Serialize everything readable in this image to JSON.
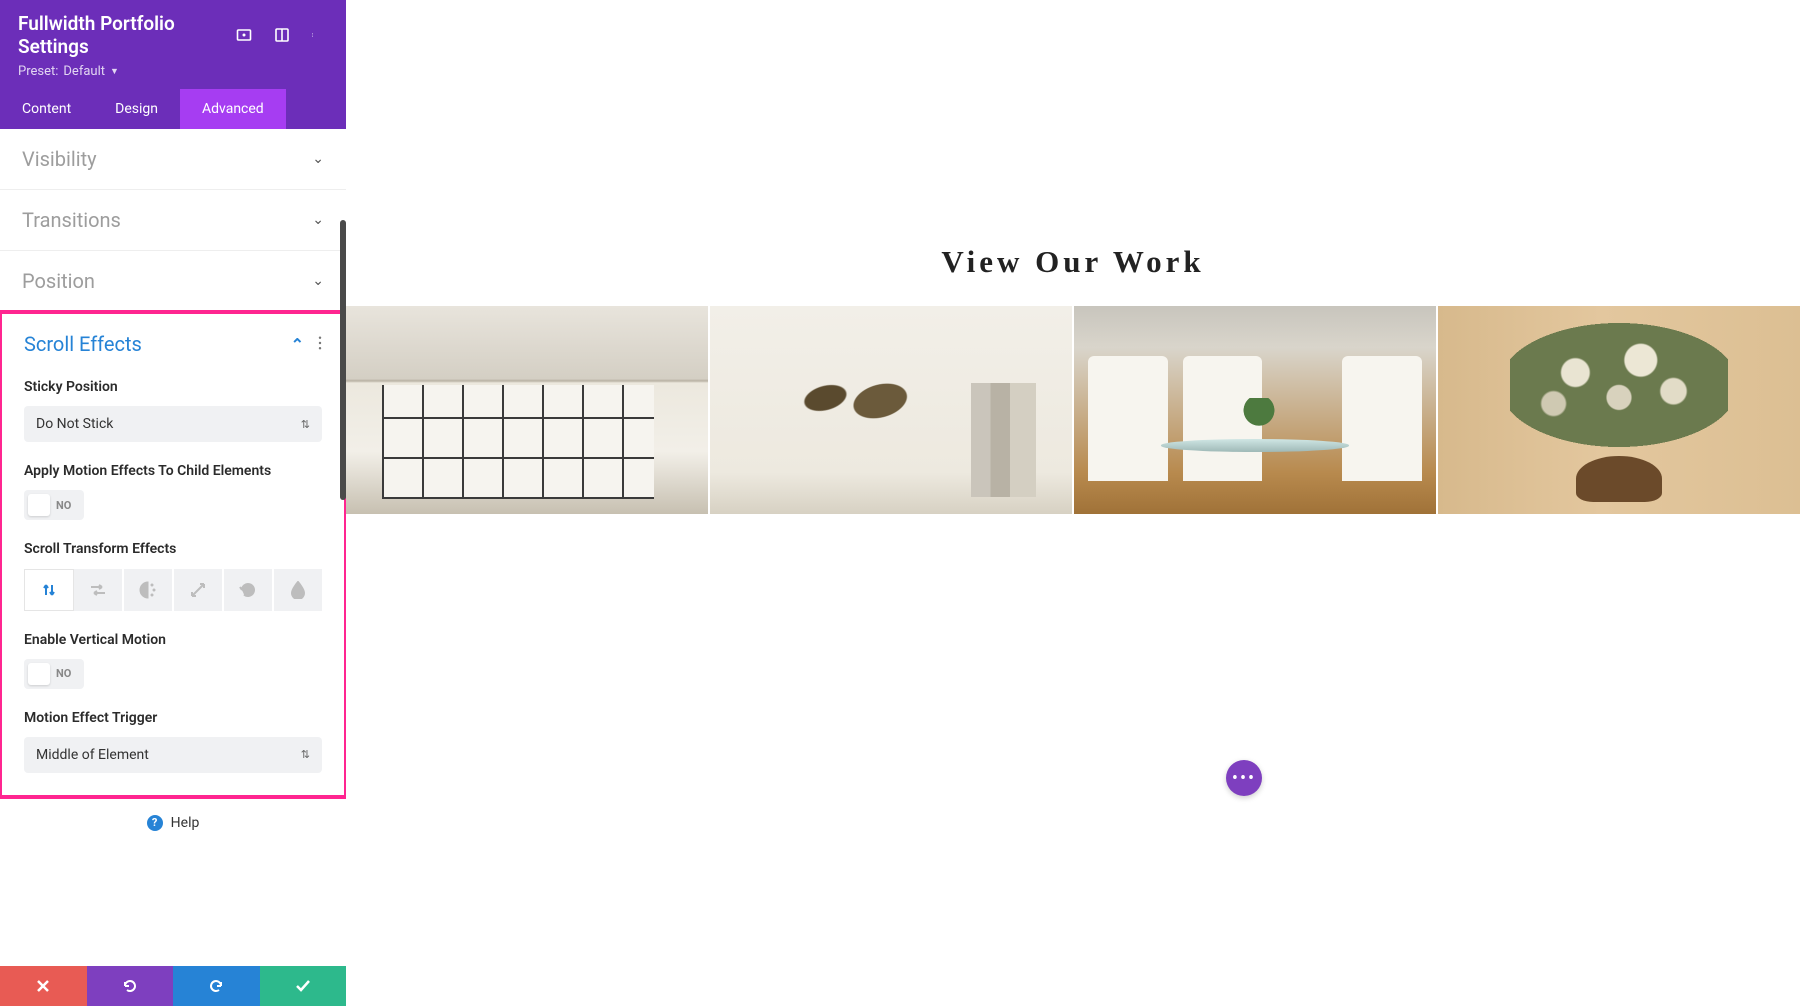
{
  "sidebar": {
    "title": "Fullwidth Portfolio Settings",
    "preset_label": "Preset:",
    "preset_value": "Default",
    "tabs": {
      "content": "Content",
      "design": "Design",
      "advanced": "Advanced"
    },
    "sections": {
      "visibility": "Visibility",
      "transitions": "Transitions",
      "position": "Position",
      "scroll_effects": "Scroll Effects"
    },
    "fields": {
      "sticky_position": {
        "label": "Sticky Position",
        "value": "Do Not Stick"
      },
      "apply_motion_children": {
        "label": "Apply Motion Effects To Child Elements",
        "value": "NO"
      },
      "scroll_transform": {
        "label": "Scroll Transform Effects"
      },
      "enable_vertical_motion": {
        "label": "Enable Vertical Motion",
        "value": "NO"
      },
      "motion_trigger": {
        "label": "Motion Effect Trigger",
        "value": "Middle of Element"
      }
    },
    "help": "Help"
  },
  "canvas": {
    "heading": "View Our Work"
  },
  "fab": "•••",
  "colors": {
    "purple_dark": "#6c2eb9",
    "purple_light": "#a63df2",
    "blue": "#2683d6",
    "green": "#2db98c",
    "red": "#e85b54",
    "highlight": "#ff2590"
  }
}
